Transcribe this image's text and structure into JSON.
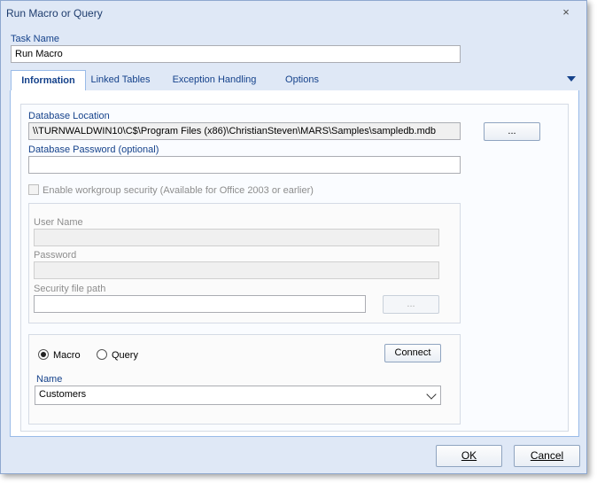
{
  "window": {
    "title": "Run Macro or Query",
    "close_icon": "×"
  },
  "task_name": {
    "label": "Task Name",
    "value": "Run Macro"
  },
  "tabs": [
    {
      "label": "Information"
    },
    {
      "label": "Linked Tables"
    },
    {
      "label": "Exception Handling"
    },
    {
      "label": "Options"
    }
  ],
  "information": {
    "db_location_label": "Database Location",
    "db_location_value": "\\\\TURNWALDWIN10\\C$\\Program Files (x86)\\ChristianSteven\\MARS\\Samples\\sampledb.mdb",
    "browse_label": "...",
    "db_password_label": "Database Password (optional)",
    "db_password_value": "",
    "workgroup_label": "Enable workgroup security (Available for Office 2003 or earlier)",
    "user_name_label": "User Name",
    "password_label": "Password",
    "security_path_label": "Security file path",
    "security_browse_label": "...",
    "macro_label": "Macro",
    "query_label": "Query",
    "connect_label": "Connect",
    "name_label": "Name",
    "name_value": "Customers"
  },
  "footer": {
    "ok_label": "OK",
    "cancel_label": "Cancel"
  }
}
